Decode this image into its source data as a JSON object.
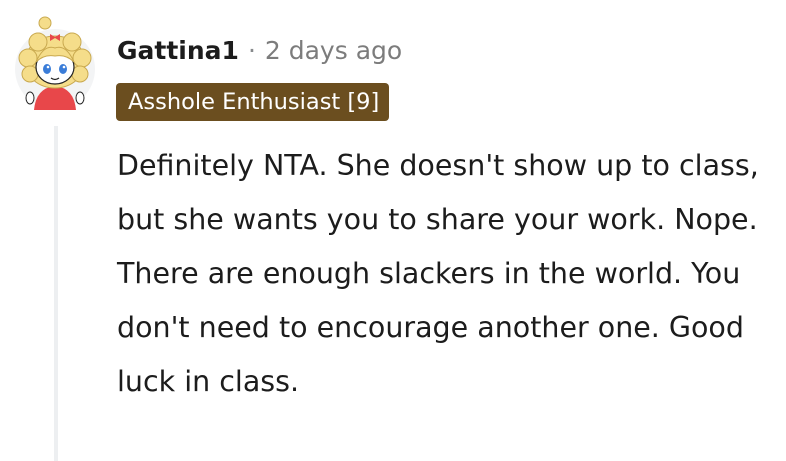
{
  "comment": {
    "username": "Gattina1",
    "separator": "·",
    "timestamp": "2 days ago",
    "flair": "Asshole Enthusiast [9]",
    "body": "Definitely NTA. She doesn't show up to class, but she wants you to share your work. Nope. There are enough slackers in the world. You don't need to encourage another one. Good luck in class."
  },
  "colors": {
    "flair_background": "#6b4e1f",
    "flair_text": "#ffffff",
    "username": "#1c1c1c",
    "timestamp": "#7c7c7c",
    "thread_line": "#edeff1"
  },
  "icons": {
    "avatar": "snoo-avatar-blonde-girl-icon"
  }
}
